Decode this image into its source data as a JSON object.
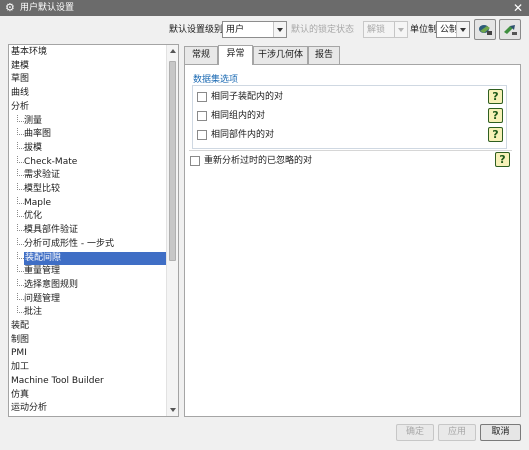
{
  "window": {
    "title": "用户默认设置",
    "close_label": "✕"
  },
  "toolbar": {
    "level_label": "默认设置级别",
    "level_value": "用户",
    "lock_label": "默认的锁定状态",
    "lock_value": "解锁",
    "unit_label": "单位制",
    "unit_value": "公制",
    "icons": [
      "manage-current-settings-icon",
      "import-export-icon"
    ]
  },
  "tree": {
    "items": [
      {
        "label": "基本环境",
        "level": 0
      },
      {
        "label": "建模",
        "level": 0
      },
      {
        "label": "草图",
        "level": 0
      },
      {
        "label": "曲线",
        "level": 0
      },
      {
        "label": "分析",
        "level": 0
      },
      {
        "label": "测量",
        "level": 1
      },
      {
        "label": "曲率图",
        "level": 1
      },
      {
        "label": "拔模",
        "level": 1
      },
      {
        "label": "Check-Mate",
        "level": 1
      },
      {
        "label": "需求验证",
        "level": 1
      },
      {
        "label": "模型比较",
        "level": 1
      },
      {
        "label": "Maple",
        "level": 1
      },
      {
        "label": "优化",
        "level": 1
      },
      {
        "label": "模具部件验证",
        "level": 1
      },
      {
        "label": "分析可成形性 - 一步式",
        "level": 1
      },
      {
        "label": "装配间隙",
        "level": 1,
        "selected": true
      },
      {
        "label": "重量管理",
        "level": 1
      },
      {
        "label": "选择意图规则",
        "level": 1
      },
      {
        "label": "问题管理",
        "level": 1
      },
      {
        "label": "批注",
        "level": 1
      },
      {
        "label": "装配",
        "level": 0
      },
      {
        "label": "制图",
        "level": 0
      },
      {
        "label": "PMI",
        "level": 0
      },
      {
        "label": "加工",
        "level": 0
      },
      {
        "label": "Machine Tool Builder",
        "level": 0
      },
      {
        "label": "仿真",
        "level": 0
      },
      {
        "label": "运动分析",
        "level": 0
      }
    ]
  },
  "tabs": [
    {
      "label": "常规"
    },
    {
      "label": "异常",
      "active": true
    },
    {
      "label": "干涉几何体"
    },
    {
      "label": "报告"
    }
  ],
  "content": {
    "group_title": "数据集选项",
    "options": [
      {
        "label": "相同子装配内的对",
        "checked": false
      },
      {
        "label": "相同组内的对",
        "checked": false
      },
      {
        "label": "相同部件内的对",
        "checked": false
      }
    ],
    "extra_option": {
      "label": "重新分析过时的已忽略的对",
      "checked": false
    },
    "help_label": "?"
  },
  "footer": {
    "ok_label": "确定",
    "apply_label": "应用",
    "cancel_label": "取消"
  },
  "colors": {
    "titlebar": "#6b6b6b",
    "selection": "#3f6ec5",
    "group_title": "#1b6ab3",
    "help_bg": "#f7f1b8"
  }
}
